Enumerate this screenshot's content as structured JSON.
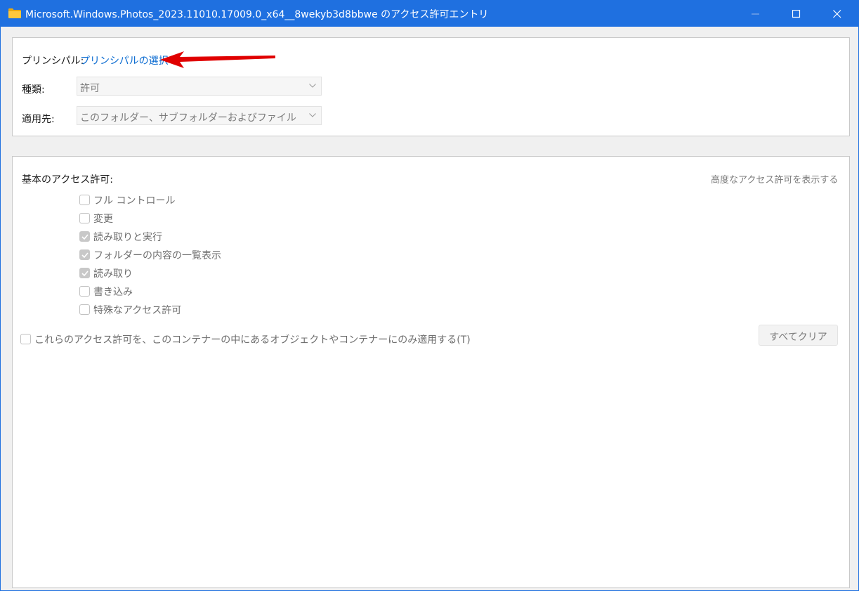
{
  "window": {
    "title": "Microsoft.Windows.Photos_2023.11010.17009.0_x64__8wekyb3d8bbwe のアクセス許可エントリ",
    "title_icon": "folder-icon",
    "controls": [
      "minimize-icon",
      "maximize-icon",
      "close-icon"
    ],
    "accent_color": "#1f70e0"
  },
  "principal": {
    "label": "プリンシパル:",
    "select_link": "プリンシパルの選択",
    "annotation": "red-arrow-icon"
  },
  "type": {
    "label": "種類:",
    "value": "許可"
  },
  "applies_to": {
    "label": "適用先:",
    "value": "このフォルダー、サブフォルダーおよびファイル"
  },
  "basic_permissions": {
    "heading": "基本のアクセス許可:",
    "show_advanced": "高度なアクセス許可を表示する",
    "items": [
      {
        "label": "フル コントロール",
        "checked": false
      },
      {
        "label": "変更",
        "checked": false
      },
      {
        "label": "読み取りと実行",
        "checked": true
      },
      {
        "label": "フォルダーの内容の一覧表示",
        "checked": true
      },
      {
        "label": "読み取り",
        "checked": true
      },
      {
        "label": "書き込み",
        "checked": false
      },
      {
        "label": "特殊なアクセス許可",
        "checked": false
      }
    ],
    "apply_only_container": {
      "label": "これらのアクセス許可を、このコンテナーの中にあるオブジェクトやコンテナーにのみ適用する(T)",
      "checked": false
    },
    "clear_all": "すべてクリア"
  }
}
